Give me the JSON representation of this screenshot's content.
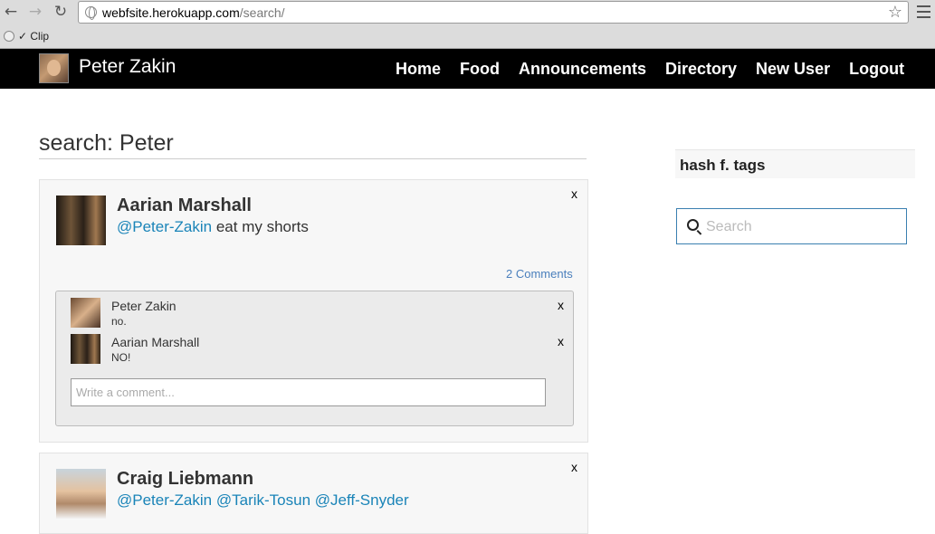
{
  "browser": {
    "url_host": "webfsite.herokuapp.com",
    "url_path": "/search/",
    "bookmark_label": "✓ Clip"
  },
  "navbar": {
    "brand": "Peter Zakin",
    "links": [
      "Home",
      "Food",
      "Announcements",
      "Directory",
      "New User",
      "Logout"
    ]
  },
  "main": {
    "search_title": "search: Peter",
    "posts": [
      {
        "author": "Aarian Marshall",
        "mentions": [
          "@Peter-Zakin"
        ],
        "text": " eat my shorts",
        "delete": "x",
        "comments_link": "2 Comments",
        "comments": [
          {
            "author": "Peter Zakin",
            "text": "no.",
            "delete": "x"
          },
          {
            "author": "Aarian Marshall",
            "text": "NO!",
            "delete": "x"
          }
        ],
        "comment_placeholder": "Write a comment..."
      },
      {
        "author": "Craig Liebmann",
        "mentions": [
          "@Peter-Zakin",
          "@Tarik-Tosun",
          "@Jeff-Snyder"
        ],
        "delete": "x"
      }
    ]
  },
  "sidebar": {
    "tags_title": "hash f. tags",
    "search_placeholder": "Search"
  }
}
